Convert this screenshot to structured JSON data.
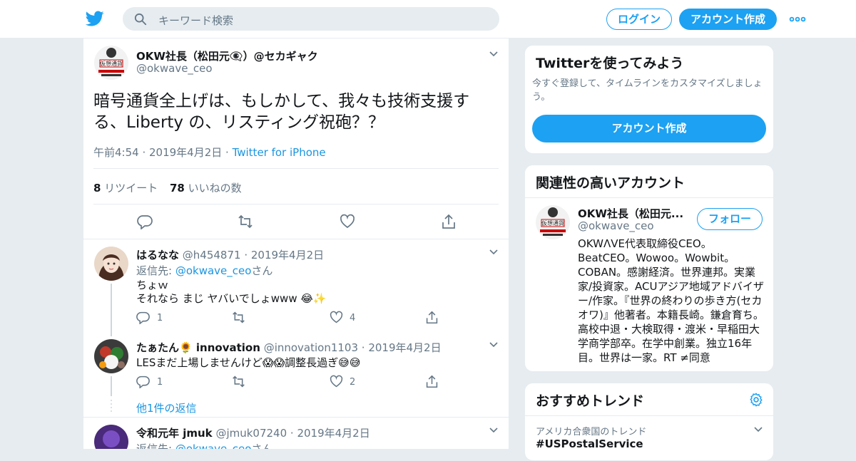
{
  "header": {
    "search_placeholder": "キーワード検索",
    "login_label": "ログイン",
    "signup_label": "アカウント作成"
  },
  "tweet": {
    "name": "OKW社長（松田元👁‍🗨）@セカギャク",
    "handle": "@okwave_ceo",
    "text": "暗号通貨全上げは、もしかして、我々も技術支援する、Liberty の、リスティング祝砲？？",
    "time": "午前4:54 · 2019年4月2日 · ",
    "source": "Twitter for iPhone",
    "retweets_count": "8",
    "retweets_label": " リツイート",
    "likes_count": "78",
    "likes_label": " いいねの数"
  },
  "replies": [
    {
      "name": "はるなな",
      "handle": "@h454871",
      "date": " · 2019年4月2日",
      "reply_prefix": "返信先: ",
      "reply_to": "@okwave_ceo",
      "reply_suffix": "さん",
      "line1": "ちょｗ",
      "line2": "それなら まじ ヤバいでしょwww 😂✨",
      "reply_count": "1",
      "like_count": "4"
    },
    {
      "name": "たぁたん🌻 innovation",
      "handle": "@innovation1103",
      "date": " · 2019年4月2日",
      "line1": "LESまだ上場しませんけど😱😱調整長過ぎ😅😅",
      "reply_count": "1",
      "like_count": "2"
    },
    {
      "name": "令和元年 jmuk",
      "handle": "@jmuk07240",
      "date": " · 2019年4月2日",
      "reply_prefix": "返信先: ",
      "reply_to": "@okwave_ceo",
      "reply_suffix": "さん"
    }
  ],
  "more_replies": "他1件の返信",
  "sidebar": {
    "try_title": "Twitterを使ってみよう",
    "try_sub": "今すぐ登録して、タイムラインをカスタマイズしましょう。",
    "try_button": "アカウント作成",
    "related_title": "関連性の高いアカウント",
    "related_name": "OKW社長（松田元...",
    "related_handle": "@okwave_ceo",
    "follow_label": "フォロー",
    "related_bio": "OKWΛVE代表取締役CEO。BeatCEO。Wowoo。Wowbit。COBAN。感謝経済。世界連邦。実業家/投資家。ACUアジア地域アドバイザー/作家。『世界の終わりの歩き方(セカオワ)』他著者。本籍長崎。鎌倉育ち。高校中退・大検取得・渡米・早稲田大学商学部卒。在学中創業。独立16年目。世界は一家。RT ≠同意",
    "trends_title": "おすすめトレンド",
    "trend_location": "アメリカ合衆国のトレンド",
    "trend_name": "#USPostalService"
  },
  "colors": {
    "accent": "#1da1f2",
    "link": "#1b95e0",
    "muted": "#657786",
    "background": "#e6ecf0"
  }
}
